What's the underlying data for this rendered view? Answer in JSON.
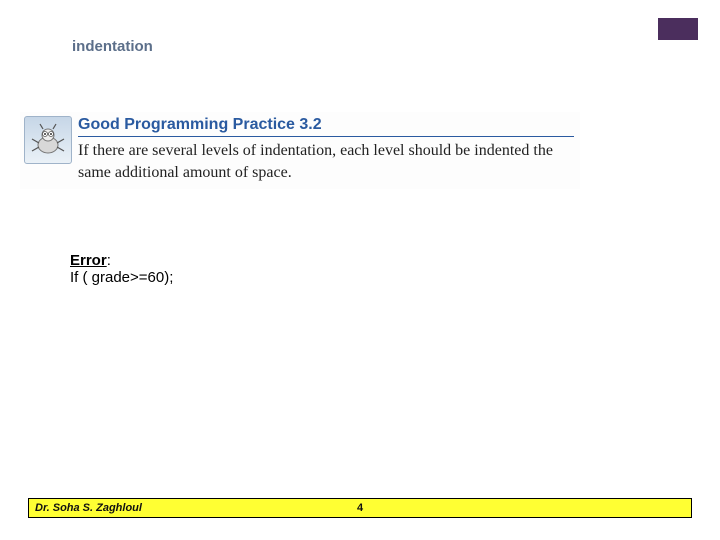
{
  "slide": {
    "title": "indentation",
    "practice": {
      "heading": "Good Programming Practice 3.2",
      "body": "If there are several levels of indentation, each level should be indented the same additional amount of space."
    },
    "error": {
      "label": "Error",
      "code": "If ( grade>=60);"
    },
    "footer": {
      "author": "Dr. Soha S. Zaghloul",
      "page": "4"
    }
  }
}
